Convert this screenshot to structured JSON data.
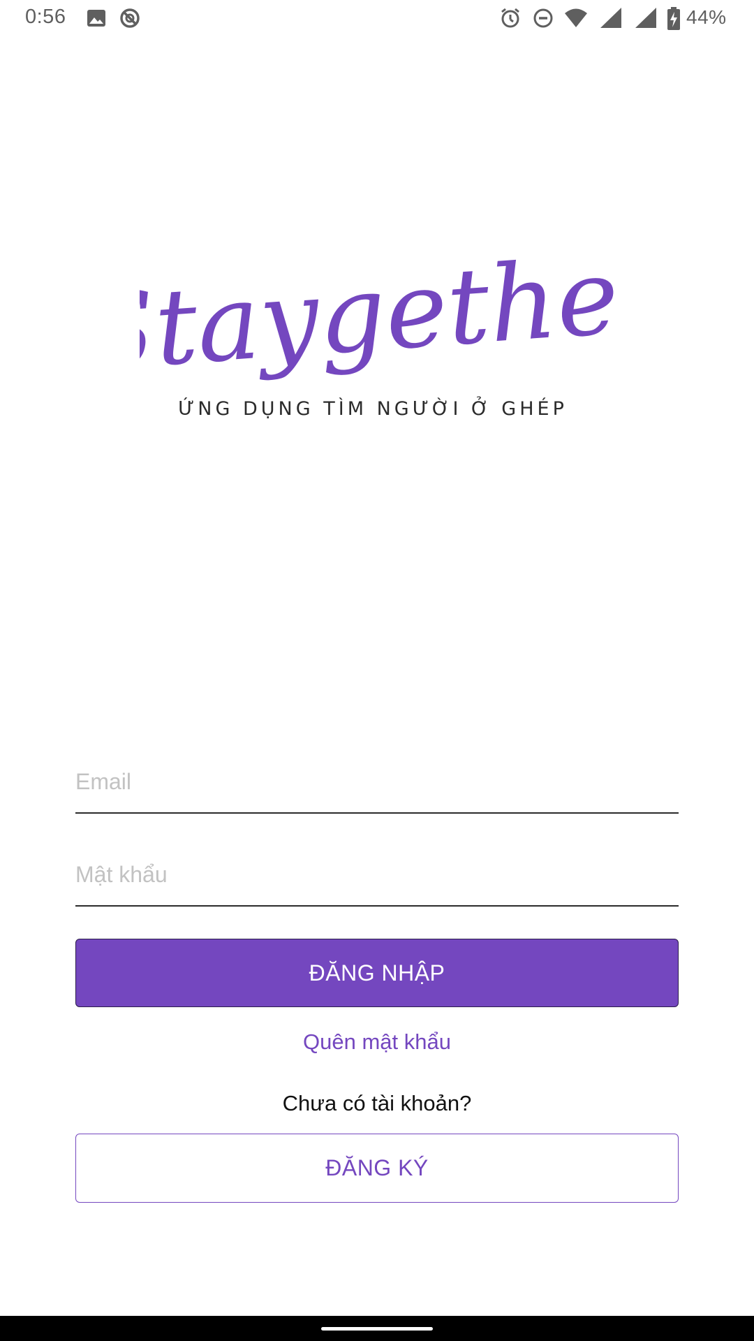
{
  "status_bar": {
    "time": "0:56",
    "battery_percent": "44%",
    "icons": [
      "image-icon",
      "sync-off-icon",
      "alarm-icon",
      "do-not-disturb-icon",
      "wifi-icon",
      "signal-icon",
      "signal-icon",
      "battery-charging-icon"
    ]
  },
  "logo": {
    "wordmark": "Staygether",
    "tagline": "ỨNG DỤNG TÌM NGƯỜI Ở GHÉP"
  },
  "form": {
    "email_placeholder": "Email",
    "email_value": "",
    "password_placeholder": "Mật khẩu",
    "password_value": "",
    "login_label": "ĐĂNG NHẬP",
    "forgot_label": "Quên mật khẩu",
    "no_account_text": "Chưa có tài khoản?",
    "register_label": "ĐĂNG KÝ"
  },
  "colors": {
    "accent": "#7447bf",
    "background": "#ffffff",
    "nav_bar": "#000000"
  }
}
